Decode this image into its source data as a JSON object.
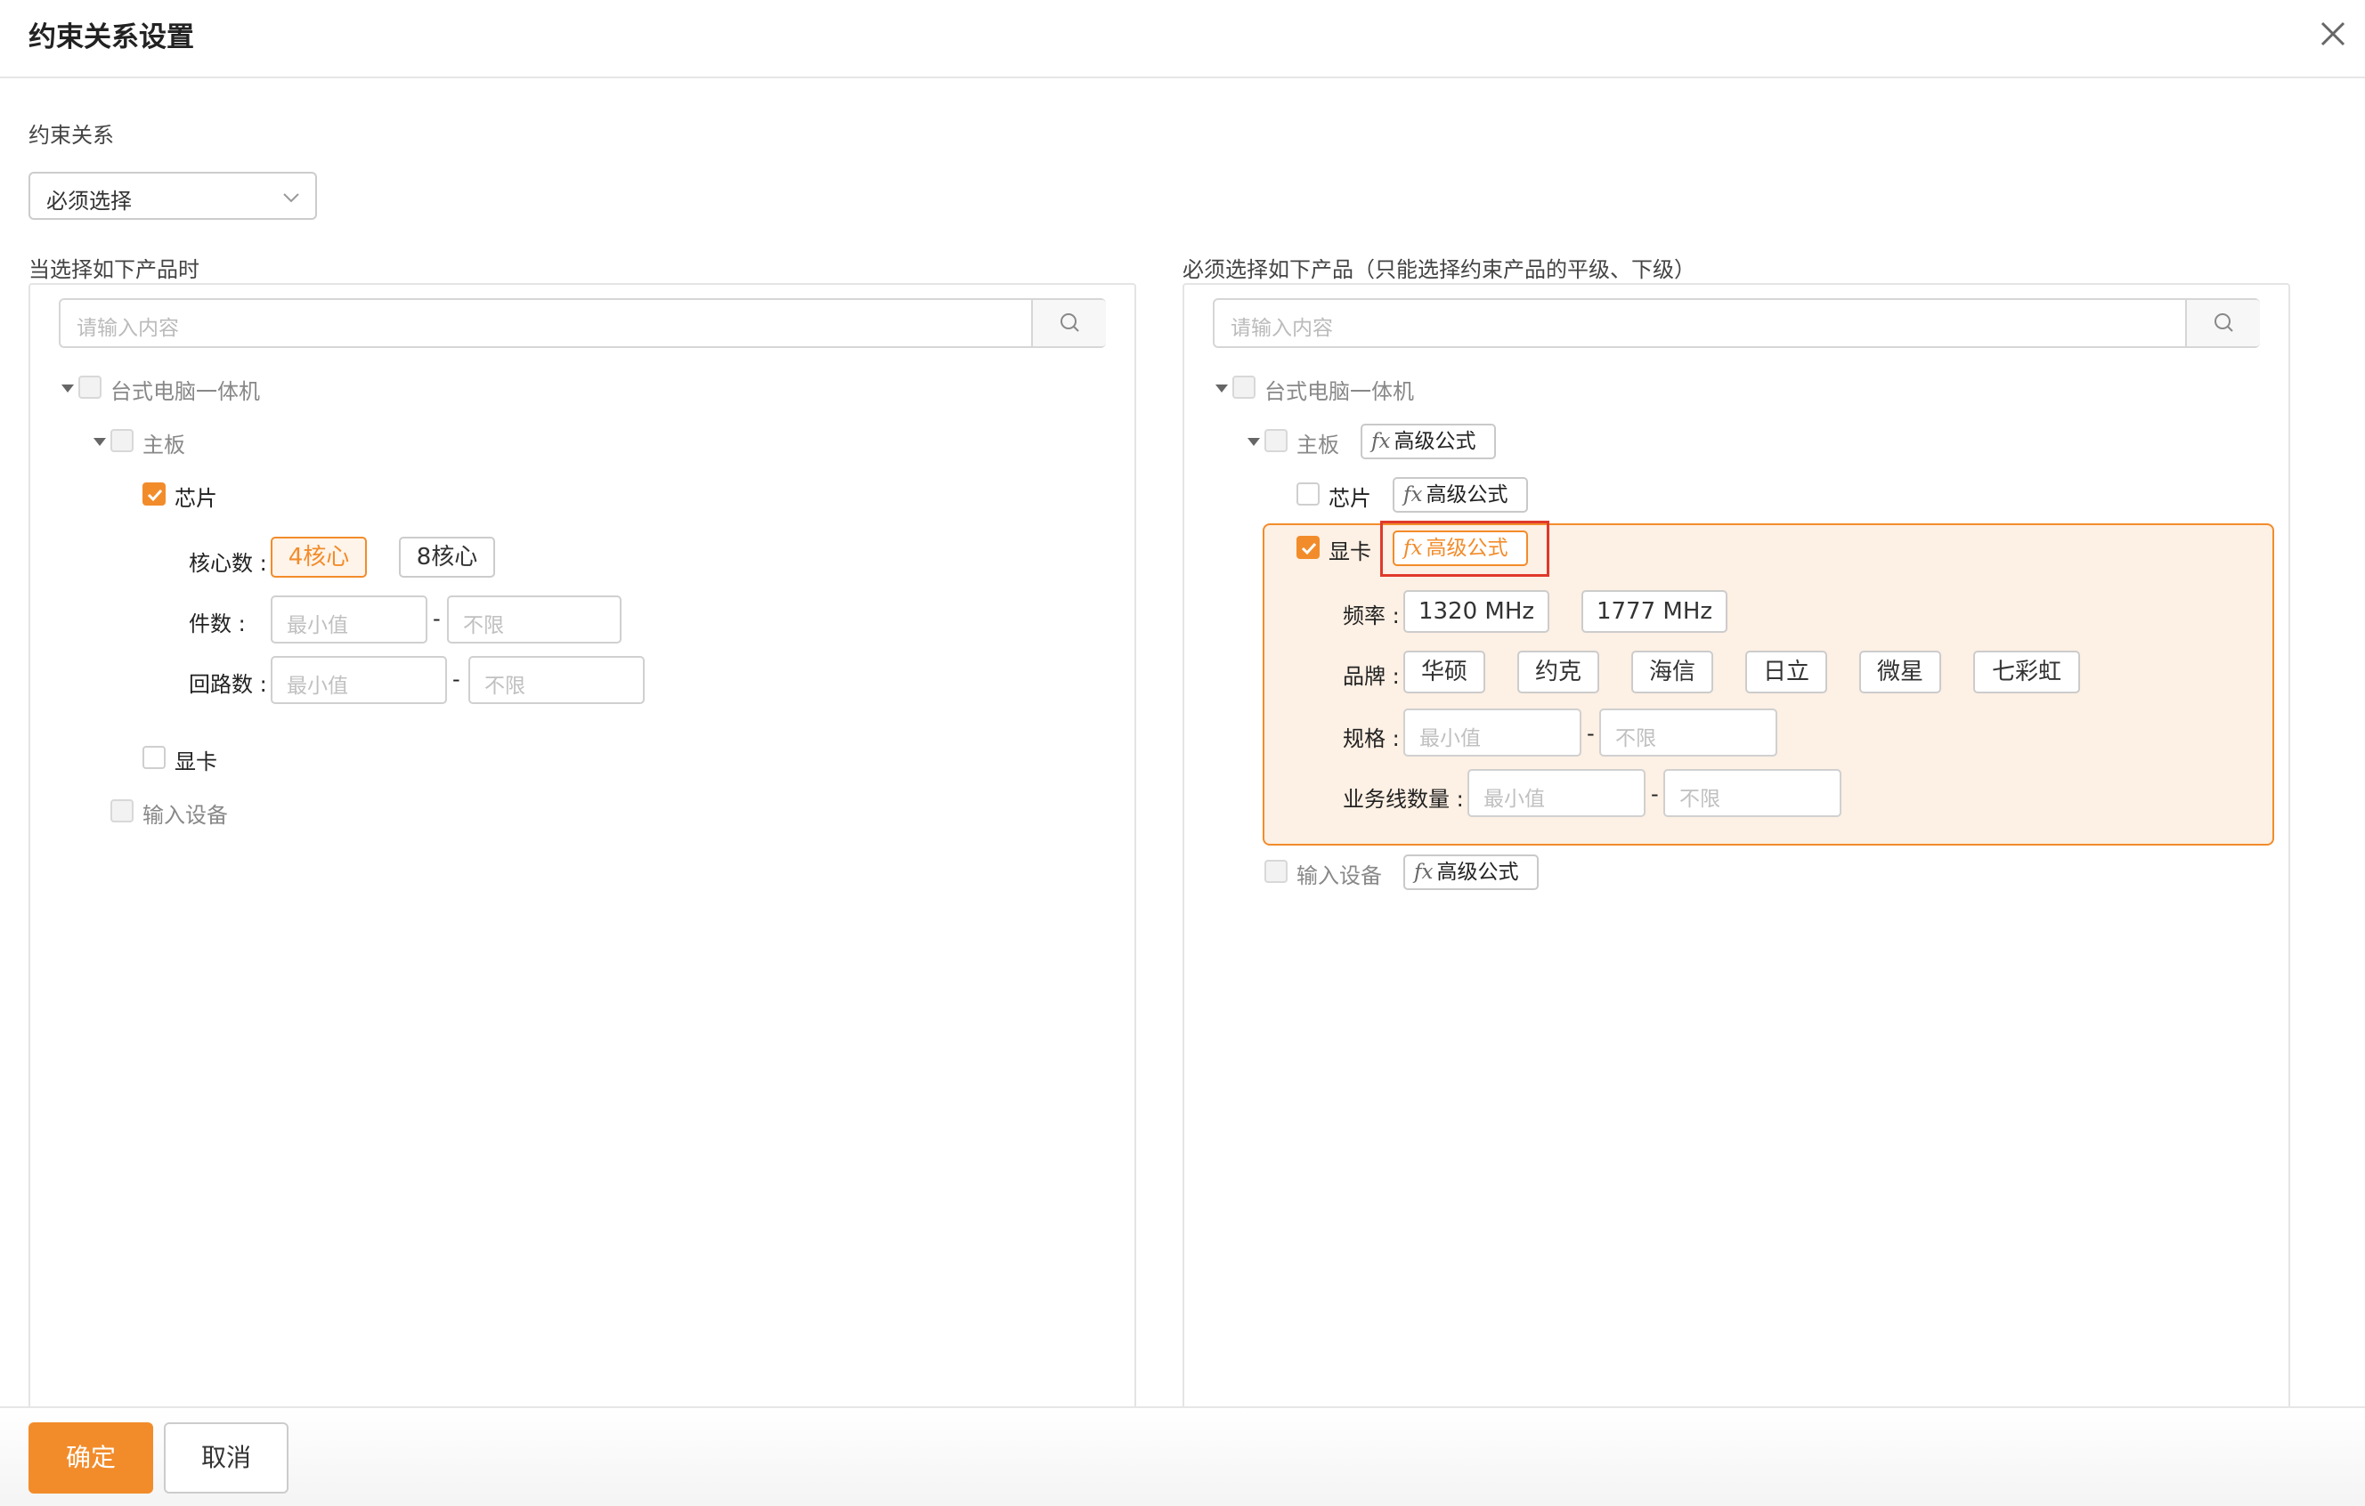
{
  "dialog": {
    "title": "约束关系设置"
  },
  "relation": {
    "label": "约束关系",
    "selected": "必须选择"
  },
  "left": {
    "label": "当选择如下产品时",
    "search_placeholder": "请输入内容",
    "tree": {
      "root": "台式电脑一体机",
      "board": "主板",
      "chip": "芯片",
      "cores_label": "核心数 :",
      "cores_options": [
        "4核心",
        "8核心"
      ],
      "pieces_label": "件数 :",
      "circuits_label": "回路数 :",
      "min_placeholder": "最小值",
      "max_placeholder": "不限",
      "gpu": "显卡",
      "input_device": "输入设备"
    }
  },
  "right": {
    "label": "必须选择如下产品（只能选择约束产品的平级、下级）",
    "search_placeholder": "请输入内容",
    "formula": "高级公式",
    "tree": {
      "root": "台式电脑一体机",
      "board": "主板",
      "chip": "芯片",
      "gpu": "显卡",
      "freq_label": "频率 :",
      "freq_options": [
        "1320 MHz",
        "1777 MHz"
      ],
      "brand_label": "品牌 :",
      "brand_options": [
        "华硕",
        "约克",
        "海信",
        "日立",
        "微星",
        "七彩虹"
      ],
      "spec_label": "规格 :",
      "biz_label": "业务线数量 :",
      "min_placeholder": "最小值",
      "max_placeholder": "不限",
      "input_device": "输入设备"
    }
  },
  "footer": {
    "confirm": "确定",
    "cancel": "取消"
  },
  "colors": {
    "accent": "#f28c2b",
    "highlight_bg": "#fdf0e4",
    "annotation_red": "#e0392b"
  }
}
